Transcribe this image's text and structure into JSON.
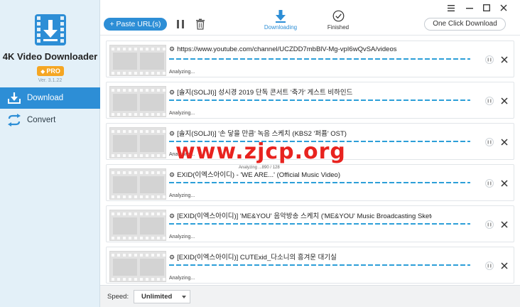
{
  "app": {
    "name": "4K Video Downloader",
    "pro_badge": "PRO",
    "version": "Ver. 3.1.22",
    "logo_icon": "film-download-icon",
    "accent": "#2d8ed6",
    "badge_color": "#f5a623"
  },
  "sidebar": {
    "items": [
      {
        "label": "Download",
        "icon": "download-tray-icon",
        "active": true
      },
      {
        "label": "Convert",
        "icon": "convert-arrows-icon",
        "active": false
      }
    ]
  },
  "toolbar": {
    "paste_label": "+ Paste URL(s)",
    "one_click_label": "One Click Download",
    "tabs": [
      {
        "label": "Downloading",
        "icon": "download-arrow-icon",
        "active": true
      },
      {
        "label": "Finished",
        "icon": "check-circle-icon",
        "active": false
      }
    ]
  },
  "downloads": [
    {
      "title": "https://www.youtube.com/channel/UCZDD7mbBlV-Mg-vpI6wQvSA/videos",
      "status": "Analyzing..."
    },
    {
      "title": "[솔지(SOLJI)] 성시경 2019 단독 콘서트 '축가' 게스트 비하인드",
      "status": "Analyzing..."
    },
    {
      "title": "[솔지(SOLJI)] '손 닿을 만큼' 녹음 스케치 (KBS2 '퍼퓸' OST)",
      "status": "Analyzing..."
    },
    {
      "title": "EXID(이엑스아이디) - 'WE ARE...' (Official Music Video)",
      "status": "Analyzing...",
      "sub_status": "Analyzing ...890 / 128"
    },
    {
      "title": "[EXID(이엑스아이디)] 'ME&YOU' 음악방송 스케치 ('ME&YOU' Music Broadcasting Sketc",
      "status": "Analyzing..."
    },
    {
      "title": "[EXID(이엑스아이디)] CUTExid_다소니의 흥겨운 대기실",
      "status": "Analyzing..."
    }
  ],
  "footer": {
    "speed_label": "Speed:",
    "speed_value": "Unlimited"
  },
  "watermark": "www.zjcp.org"
}
